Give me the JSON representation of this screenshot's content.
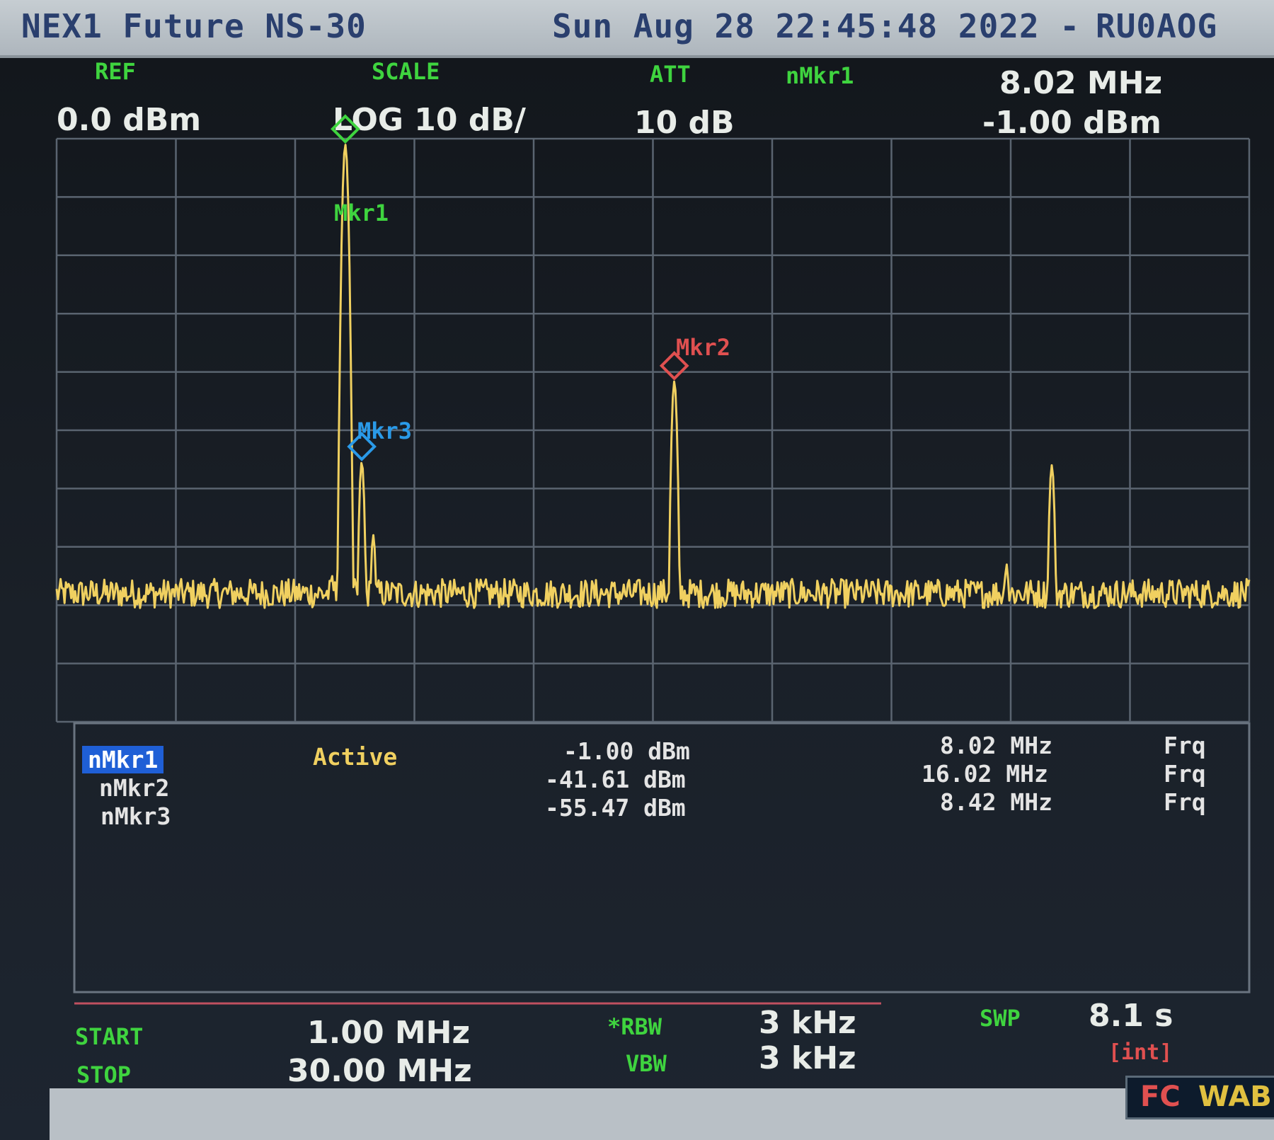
{
  "title": {
    "device": "NEX1 Future NS-30",
    "datetime": "Sun Aug 28 22:45:48 2022 -",
    "callsign": "RU0AOG"
  },
  "header": {
    "ref_label": "REF",
    "ref_value": "0.0 dBm",
    "scale_label": "SCALE",
    "scale_value": "LOG 10 dB/",
    "att_label": "ATT",
    "att_value": "10 dB",
    "nmkr_label": "nMkr1",
    "nmkr_freq": "8.02 MHz",
    "nmkr_level": "-1.00 dBm"
  },
  "markers": {
    "mkr1_label": "Mkr1",
    "mkr2_label": "Mkr2",
    "mkr3_label": "Mkr3",
    "active_label": "Active",
    "rows": [
      {
        "name": "nMkr1",
        "level": "-1.00 dBm",
        "freq": "8.02 MHz",
        "mode": "Frq"
      },
      {
        "name": "nMkr2",
        "level": "-41.61 dBm",
        "freq": "16.02 MHz",
        "mode": "Frq"
      },
      {
        "name": "nMkr3",
        "level": "-55.47 dBm",
        "freq": "8.42 MHz",
        "mode": "Frq"
      }
    ]
  },
  "footer": {
    "start_label": "START",
    "start_value": "1.00 MHz",
    "stop_label": "STOP",
    "stop_value": "30.00 MHz",
    "rbw_label": "*RBW",
    "rbw_value": "3 kHz",
    "vbw_label": "VBW",
    "vbw_value": "3 kHz",
    "swp_label": "SWP",
    "swp_value": "8.1 s",
    "swp_mode": "[int]"
  },
  "badge": {
    "fc": "FC",
    "wabi": "WABI"
  },
  "colors": {
    "trace": "#f0d060",
    "grid": "#5a6470",
    "mkr1": "#3fd43f",
    "mkr2": "#e05050",
    "mkr3": "#2a9ae8"
  },
  "chart_data": {
    "type": "line",
    "x_unit": "MHz",
    "y_unit": "dBm",
    "xlim": [
      1.0,
      30.0
    ],
    "ylim": [
      -100,
      0
    ],
    "grid": true,
    "peaks": [
      {
        "x": 7.3,
        "y": -84
      },
      {
        "x": 7.7,
        "y": -75
      },
      {
        "x": 8.02,
        "y": -1.0
      },
      {
        "x": 8.42,
        "y": -55.47
      },
      {
        "x": 8.7,
        "y": -68
      },
      {
        "x": 9.2,
        "y": -82
      },
      {
        "x": 16.02,
        "y": -41.61
      },
      {
        "x": 22.9,
        "y": -80
      },
      {
        "x": 24.1,
        "y": -73
      },
      {
        "x": 25.2,
        "y": -56
      }
    ],
    "noise_floor": -78
  }
}
